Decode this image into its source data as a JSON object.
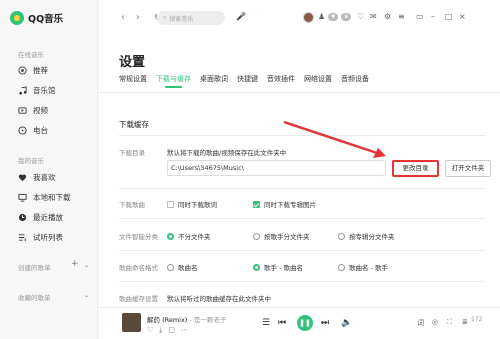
{
  "app": {
    "name": "QQ音乐"
  },
  "sidebar": {
    "online_section": "在线音乐",
    "online_items": [
      {
        "label": "推荐",
        "icon": "recommend-icon"
      },
      {
        "label": "音乐馆",
        "icon": "music-hall-icon"
      },
      {
        "label": "视频",
        "icon": "video-icon"
      },
      {
        "label": "电台",
        "icon": "radio-icon"
      }
    ],
    "my_section": "我的音乐",
    "my_items": [
      {
        "label": "我喜欢",
        "icon": "heart-icon"
      },
      {
        "label": "本地和下载",
        "icon": "computer-icon"
      },
      {
        "label": "最近播放",
        "icon": "clock-icon"
      },
      {
        "label": "试听列表",
        "icon": "playlist-icon"
      }
    ],
    "created_section": "创建的歌单",
    "collected_section": "收藏的歌单"
  },
  "header": {
    "search_placeholder": "搜索音乐"
  },
  "settings": {
    "title": "设置",
    "tabs": [
      "常规设置",
      "下载与缓存",
      "桌面歌词",
      "快捷键",
      "音效插件",
      "网络设置",
      "音频设备"
    ],
    "active_tab": 1,
    "section_title": "下载缓存",
    "download_dir": {
      "label": "下载目录",
      "hint": "默认将下载的歌曲/视频保存在此文件夹中",
      "path": "C:\\Users\\34675\\Music\\",
      "change_button": "更改目录",
      "open_button": "打开文件夹"
    },
    "download_songs": {
      "label": "下载歌曲",
      "options": [
        {
          "label": "同时下载歌词",
          "checked": false
        },
        {
          "label": "同时下载专辑图片",
          "checked": true
        }
      ]
    },
    "smart_folder": {
      "label": "文件智能分类",
      "options": [
        {
          "label": "不分文件夹",
          "selected": true
        },
        {
          "label": "按歌手分文件夹",
          "selected": false
        },
        {
          "label": "按专辑分文件夹",
          "selected": false
        }
      ]
    },
    "naming": {
      "label": "歌曲命名格式",
      "options": [
        {
          "label": "歌曲名",
          "selected": false
        },
        {
          "label": "歌手 - 歌曲名",
          "selected": true
        },
        {
          "label": "歌曲名 - 歌手",
          "selected": false
        }
      ]
    },
    "cache": {
      "label": "歌曲缓存设置",
      "hint": "默认将听过的歌曲缓存在此文件夹中"
    }
  },
  "player": {
    "song": "解药 (Remix)",
    "artist": "是一颗老子",
    "lyrics_label": "词",
    "count": "172"
  },
  "colors": {
    "accent": "#31c27c",
    "highlight": "#e23535"
  }
}
